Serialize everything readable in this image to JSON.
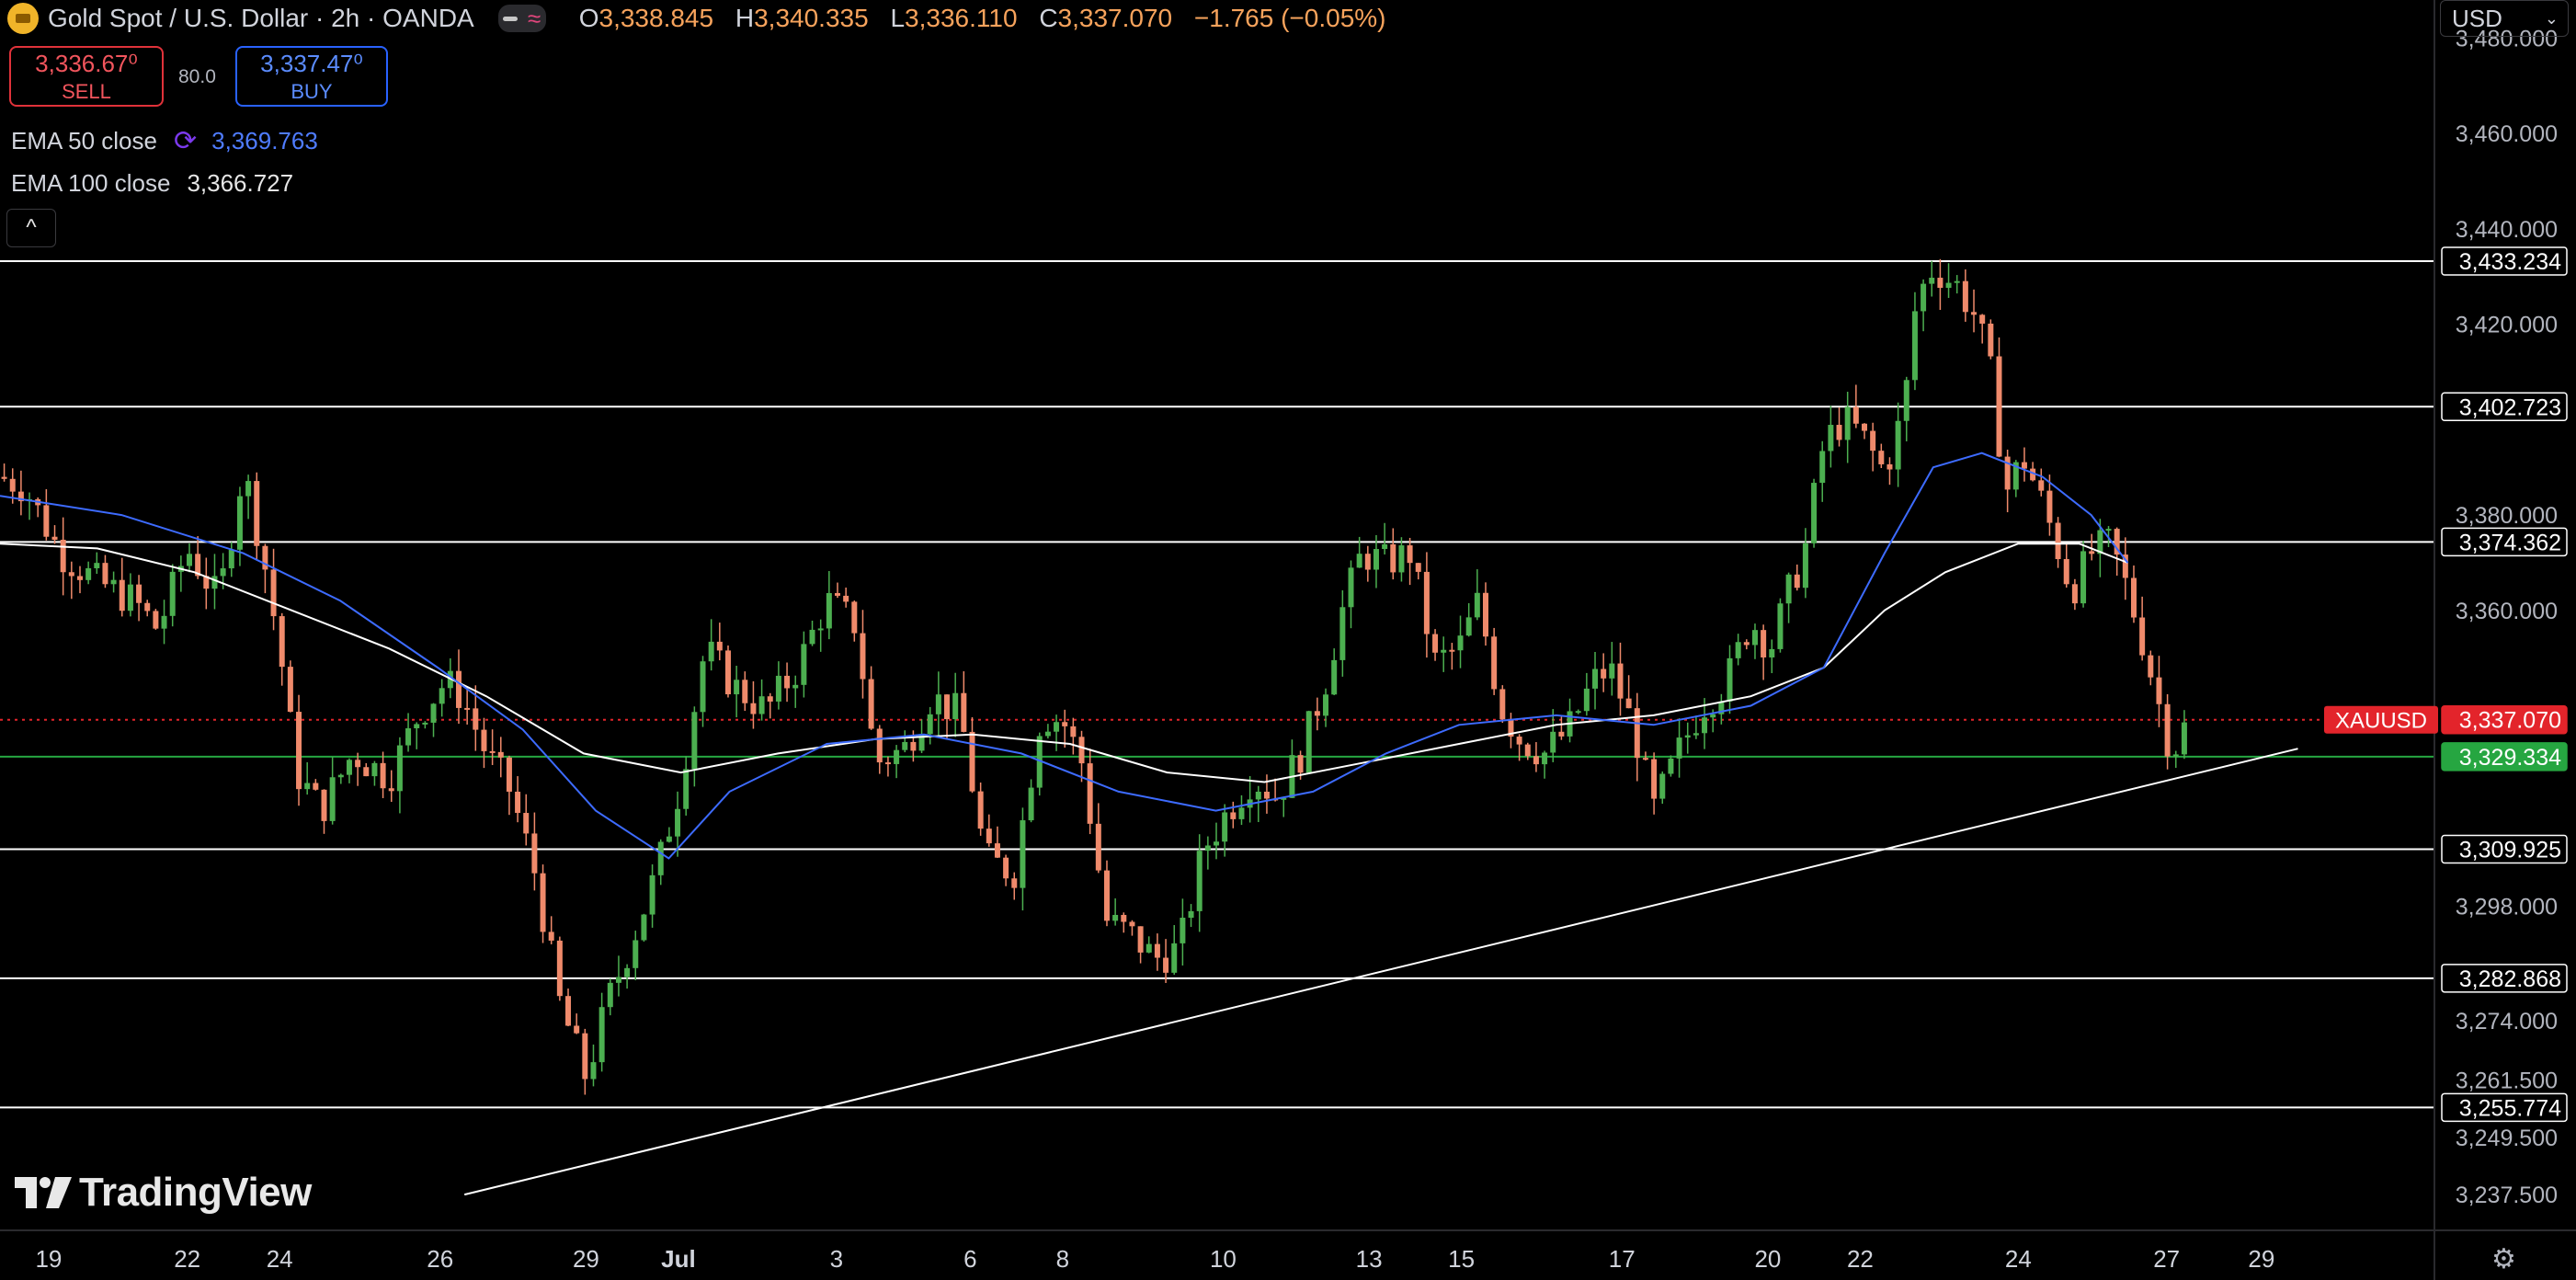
{
  "header": {
    "symbol_title": "Gold Spot / U.S. Dollar · 2h · OANDA",
    "ohlc": [
      {
        "label": "O",
        "value": "3,338.845"
      },
      {
        "label": "H",
        "value": "3,340.335"
      },
      {
        "label": "L",
        "value": "3,336.110"
      },
      {
        "label": "C",
        "value": "3,337.070"
      }
    ],
    "change": "−1.765 (−0.05%)",
    "wave_icon": "≈"
  },
  "trade": {
    "sell_price": "3,336.67⁰",
    "sell_label": "SELL",
    "buy_price": "3,337.47⁰",
    "buy_label": "BUY",
    "spread": "80.0"
  },
  "indicators": {
    "ema50_label": "EMA 50 close",
    "ema50_value": "3,369.763",
    "ema100_label": "EMA 100 close",
    "ema100_value": "3,366.727"
  },
  "collapse_icon": "^",
  "currency_button": "USD",
  "branding": "TradingView",
  "colors": {
    "up": "#26a69a",
    "up_candle": "#4caf50",
    "down_candle": "#ef8a6b",
    "ema50": "#3d6bff",
    "ema100": "#ffffff",
    "price_tag": "#e3242b",
    "support_tag": "#26a641",
    "level_line": "#ffffff"
  },
  "chart_data": {
    "type": "candlestick",
    "title": "Gold Spot / U.S. Dollar · 2h · OANDA",
    "ylim": [
      3230,
      3488
    ],
    "y_ticks": [
      "3,480.000",
      "3,460.000",
      "3,440.000",
      "3,420.000",
      "3,380.000",
      "3,360.000",
      "3,298.000",
      "3,274.000",
      "3,261.500",
      "3,249.500",
      "3,237.500"
    ],
    "y_ticks_values": [
      3480,
      3460,
      3440,
      3420,
      3380,
      3360,
      3298,
      3274,
      3261.5,
      3249.5,
      3237.5
    ],
    "x_ticks": [
      "19",
      "22",
      "24",
      "26",
      "29",
      "Jul",
      "3",
      "6",
      "8",
      "10",
      "13",
      "15",
      "17",
      "20",
      "22",
      "24",
      "27",
      "29"
    ],
    "x_tick_frac": [
      0.02,
      0.077,
      0.115,
      0.181,
      0.241,
      0.279,
      0.344,
      0.399,
      0.437,
      0.503,
      0.563,
      0.601,
      0.667,
      0.727,
      0.765,
      0.83,
      0.891,
      0.93
    ],
    "horizontal_levels": [
      {
        "value": 3433.234,
        "label": "3,433.234"
      },
      {
        "value": 3402.723,
        "label": "3,402.723"
      },
      {
        "value": 3374.362,
        "label": "3,374.362"
      },
      {
        "value": 3309.925,
        "label": "3,309.925"
      },
      {
        "value": 3282.868,
        "label": "3,282.868"
      },
      {
        "value": 3255.774,
        "label": "3,255.774"
      }
    ],
    "support_level": {
      "value": 3329.334,
      "label": "3,329.334"
    },
    "current_price": {
      "value": 3337.07,
      "label": "3,337.070",
      "symbol": "XAUUSD"
    },
    "trendline": [
      {
        "x_frac": 0.191,
        "y": 3237.5
      },
      {
        "x_frac": 0.945,
        "y": 3331
      }
    ],
    "price_path": [
      [
        0.0,
        3388
      ],
      [
        0.01,
        3386
      ],
      [
        0.025,
        3372
      ],
      [
        0.04,
        3366
      ],
      [
        0.055,
        3362
      ],
      [
        0.065,
        3356
      ],
      [
        0.077,
        3373
      ],
      [
        0.09,
        3362
      ],
      [
        0.1,
        3390
      ],
      [
        0.108,
        3372
      ],
      [
        0.115,
        3352
      ],
      [
        0.122,
        3326
      ],
      [
        0.132,
        3318
      ],
      [
        0.145,
        3330
      ],
      [
        0.16,
        3325
      ],
      [
        0.172,
        3338
      ],
      [
        0.183,
        3345
      ],
      [
        0.19,
        3342
      ],
      [
        0.2,
        3330
      ],
      [
        0.21,
        3322
      ],
      [
        0.22,
        3305
      ],
      [
        0.23,
        3278
      ],
      [
        0.241,
        3262
      ],
      [
        0.25,
        3278
      ],
      [
        0.263,
        3295
      ],
      [
        0.27,
        3305
      ],
      [
        0.279,
        3322
      ],
      [
        0.29,
        3352
      ],
      [
        0.302,
        3344
      ],
      [
        0.315,
        3339
      ],
      [
        0.328,
        3348
      ],
      [
        0.34,
        3362
      ],
      [
        0.352,
        3357
      ],
      [
        0.36,
        3328
      ],
      [
        0.372,
        3331
      ],
      [
        0.383,
        3342
      ],
      [
        0.395,
        3338
      ],
      [
        0.405,
        3308
      ],
      [
        0.417,
        3305
      ],
      [
        0.428,
        3338
      ],
      [
        0.437,
        3337
      ],
      [
        0.445,
        3328
      ],
      [
        0.455,
        3295
      ],
      [
        0.465,
        3292
      ],
      [
        0.475,
        3287
      ],
      [
        0.485,
        3289
      ],
      [
        0.495,
        3310
      ],
      [
        0.505,
        3318
      ],
      [
        0.515,
        3325
      ],
      [
        0.525,
        3321
      ],
      [
        0.535,
        3330
      ],
      [
        0.545,
        3345
      ],
      [
        0.552,
        3360
      ],
      [
        0.56,
        3372
      ],
      [
        0.57,
        3370
      ],
      [
        0.58,
        3372
      ],
      [
        0.59,
        3349
      ],
      [
        0.6,
        3352
      ],
      [
        0.608,
        3362
      ],
      [
        0.617,
        3340
      ],
      [
        0.625,
        3333
      ],
      [
        0.635,
        3330
      ],
      [
        0.645,
        3335
      ],
      [
        0.655,
        3345
      ],
      [
        0.662,
        3348
      ],
      [
        0.672,
        3335
      ],
      [
        0.68,
        3318
      ],
      [
        0.69,
        3330
      ],
      [
        0.7,
        3340
      ],
      [
        0.71,
        3345
      ],
      [
        0.72,
        3358
      ],
      [
        0.728,
        3352
      ],
      [
        0.735,
        3363
      ],
      [
        0.742,
        3372
      ],
      [
        0.75,
        3395
      ],
      [
        0.758,
        3400
      ],
      [
        0.765,
        3397
      ],
      [
        0.775,
        3389
      ],
      [
        0.783,
        3402
      ],
      [
        0.788,
        3425
      ],
      [
        0.795,
        3432
      ],
      [
        0.805,
        3428
      ],
      [
        0.812,
        3422
      ],
      [
        0.818,
        3412
      ],
      [
        0.825,
        3385
      ],
      [
        0.832,
        3392
      ],
      [
        0.838,
        3385
      ],
      [
        0.845,
        3375
      ],
      [
        0.852,
        3364
      ],
      [
        0.86,
        3372
      ],
      [
        0.868,
        3374
      ],
      [
        0.875,
        3364
      ],
      [
        0.882,
        3352
      ],
      [
        0.888,
        3340
      ],
      [
        0.893,
        3330
      ],
      [
        0.9,
        3337
      ]
    ],
    "ema50_path": [
      [
        0.0,
        3384
      ],
      [
        0.05,
        3380
      ],
      [
        0.1,
        3372
      ],
      [
        0.14,
        3362
      ],
      [
        0.18,
        3348
      ],
      [
        0.215,
        3335
      ],
      [
        0.245,
        3318
      ],
      [
        0.275,
        3308
      ],
      [
        0.3,
        3322
      ],
      [
        0.34,
        3332
      ],
      [
        0.38,
        3334
      ],
      [
        0.42,
        3330
      ],
      [
        0.46,
        3322
      ],
      [
        0.5,
        3318
      ],
      [
        0.54,
        3322
      ],
      [
        0.57,
        3330
      ],
      [
        0.6,
        3336
      ],
      [
        0.64,
        3338
      ],
      [
        0.68,
        3336
      ],
      [
        0.72,
        3340
      ],
      [
        0.75,
        3348
      ],
      [
        0.775,
        3372
      ],
      [
        0.795,
        3390
      ],
      [
        0.815,
        3393
      ],
      [
        0.84,
        3388
      ],
      [
        0.86,
        3380
      ],
      [
        0.875,
        3370
      ]
    ],
    "ema100_path": [
      [
        0.0,
        3374
      ],
      [
        0.04,
        3373
      ],
      [
        0.08,
        3368
      ],
      [
        0.12,
        3360
      ],
      [
        0.16,
        3352
      ],
      [
        0.2,
        3342
      ],
      [
        0.24,
        3330
      ],
      [
        0.28,
        3326
      ],
      [
        0.32,
        3330
      ],
      [
        0.36,
        3333
      ],
      [
        0.4,
        3334
      ],
      [
        0.44,
        3332
      ],
      [
        0.48,
        3326
      ],
      [
        0.52,
        3324
      ],
      [
        0.56,
        3328
      ],
      [
        0.6,
        3332
      ],
      [
        0.64,
        3336
      ],
      [
        0.68,
        3338
      ],
      [
        0.72,
        3342
      ],
      [
        0.75,
        3348
      ],
      [
        0.775,
        3360
      ],
      [
        0.8,
        3368
      ],
      [
        0.83,
        3374
      ],
      [
        0.855,
        3374
      ],
      [
        0.875,
        3370
      ]
    ]
  }
}
